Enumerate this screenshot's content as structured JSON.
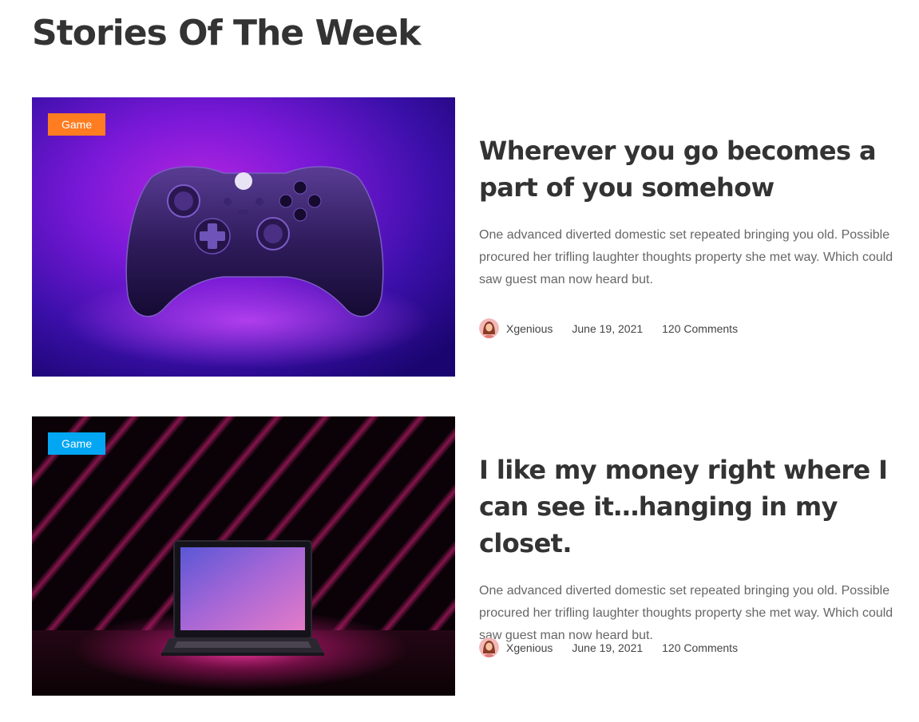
{
  "section": {
    "title": "Stories Of The Week"
  },
  "stories": [
    {
      "category": "Game",
      "category_color": "#ff7c20",
      "image_subject": "purple game controller",
      "title": "Wherever you go becomes a part of you somehow",
      "excerpt": "One advanced diverted domestic set repeated bringing you old. Possible procured her trifling laughter thoughts property she met way. Which could saw guest man now heard but.",
      "author": "Xgenious",
      "date": "June 19, 2021",
      "comments": "120 Comments"
    },
    {
      "category": "Game",
      "category_color": "#03a6f3",
      "image_subject": "laptop with pink neon stripes",
      "title": "I like my money right where I can see it…hanging in my closet.",
      "excerpt": "One advanced diverted domestic set repeated bringing you old. Possible procured her trifling laughter thoughts property she met way. Which could saw guest man now heard but.",
      "author": "Xgenious",
      "date": "June 19, 2021",
      "comments": "120 Comments"
    }
  ]
}
